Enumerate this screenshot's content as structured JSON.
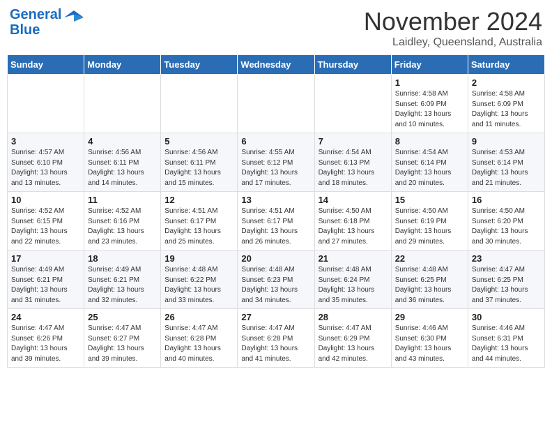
{
  "header": {
    "logo_general": "General",
    "logo_blue": "Blue",
    "month": "November 2024",
    "location": "Laidley, Queensland, Australia"
  },
  "days_of_week": [
    "Sunday",
    "Monday",
    "Tuesday",
    "Wednesday",
    "Thursday",
    "Friday",
    "Saturday"
  ],
  "weeks": [
    [
      {
        "day": "",
        "info": ""
      },
      {
        "day": "",
        "info": ""
      },
      {
        "day": "",
        "info": ""
      },
      {
        "day": "",
        "info": ""
      },
      {
        "day": "",
        "info": ""
      },
      {
        "day": "1",
        "info": "Sunrise: 4:58 AM\nSunset: 6:09 PM\nDaylight: 13 hours\nand 10 minutes."
      },
      {
        "day": "2",
        "info": "Sunrise: 4:58 AM\nSunset: 6:09 PM\nDaylight: 13 hours\nand 11 minutes."
      }
    ],
    [
      {
        "day": "3",
        "info": "Sunrise: 4:57 AM\nSunset: 6:10 PM\nDaylight: 13 hours\nand 13 minutes."
      },
      {
        "day": "4",
        "info": "Sunrise: 4:56 AM\nSunset: 6:11 PM\nDaylight: 13 hours\nand 14 minutes."
      },
      {
        "day": "5",
        "info": "Sunrise: 4:56 AM\nSunset: 6:11 PM\nDaylight: 13 hours\nand 15 minutes."
      },
      {
        "day": "6",
        "info": "Sunrise: 4:55 AM\nSunset: 6:12 PM\nDaylight: 13 hours\nand 17 minutes."
      },
      {
        "day": "7",
        "info": "Sunrise: 4:54 AM\nSunset: 6:13 PM\nDaylight: 13 hours\nand 18 minutes."
      },
      {
        "day": "8",
        "info": "Sunrise: 4:54 AM\nSunset: 6:14 PM\nDaylight: 13 hours\nand 20 minutes."
      },
      {
        "day": "9",
        "info": "Sunrise: 4:53 AM\nSunset: 6:14 PM\nDaylight: 13 hours\nand 21 minutes."
      }
    ],
    [
      {
        "day": "10",
        "info": "Sunrise: 4:52 AM\nSunset: 6:15 PM\nDaylight: 13 hours\nand 22 minutes."
      },
      {
        "day": "11",
        "info": "Sunrise: 4:52 AM\nSunset: 6:16 PM\nDaylight: 13 hours\nand 23 minutes."
      },
      {
        "day": "12",
        "info": "Sunrise: 4:51 AM\nSunset: 6:17 PM\nDaylight: 13 hours\nand 25 minutes."
      },
      {
        "day": "13",
        "info": "Sunrise: 4:51 AM\nSunset: 6:17 PM\nDaylight: 13 hours\nand 26 minutes."
      },
      {
        "day": "14",
        "info": "Sunrise: 4:50 AM\nSunset: 6:18 PM\nDaylight: 13 hours\nand 27 minutes."
      },
      {
        "day": "15",
        "info": "Sunrise: 4:50 AM\nSunset: 6:19 PM\nDaylight: 13 hours\nand 29 minutes."
      },
      {
        "day": "16",
        "info": "Sunrise: 4:50 AM\nSunset: 6:20 PM\nDaylight: 13 hours\nand 30 minutes."
      }
    ],
    [
      {
        "day": "17",
        "info": "Sunrise: 4:49 AM\nSunset: 6:21 PM\nDaylight: 13 hours\nand 31 minutes."
      },
      {
        "day": "18",
        "info": "Sunrise: 4:49 AM\nSunset: 6:21 PM\nDaylight: 13 hours\nand 32 minutes."
      },
      {
        "day": "19",
        "info": "Sunrise: 4:48 AM\nSunset: 6:22 PM\nDaylight: 13 hours\nand 33 minutes."
      },
      {
        "day": "20",
        "info": "Sunrise: 4:48 AM\nSunset: 6:23 PM\nDaylight: 13 hours\nand 34 minutes."
      },
      {
        "day": "21",
        "info": "Sunrise: 4:48 AM\nSunset: 6:24 PM\nDaylight: 13 hours\nand 35 minutes."
      },
      {
        "day": "22",
        "info": "Sunrise: 4:48 AM\nSunset: 6:25 PM\nDaylight: 13 hours\nand 36 minutes."
      },
      {
        "day": "23",
        "info": "Sunrise: 4:47 AM\nSunset: 6:25 PM\nDaylight: 13 hours\nand 37 minutes."
      }
    ],
    [
      {
        "day": "24",
        "info": "Sunrise: 4:47 AM\nSunset: 6:26 PM\nDaylight: 13 hours\nand 39 minutes."
      },
      {
        "day": "25",
        "info": "Sunrise: 4:47 AM\nSunset: 6:27 PM\nDaylight: 13 hours\nand 39 minutes."
      },
      {
        "day": "26",
        "info": "Sunrise: 4:47 AM\nSunset: 6:28 PM\nDaylight: 13 hours\nand 40 minutes."
      },
      {
        "day": "27",
        "info": "Sunrise: 4:47 AM\nSunset: 6:28 PM\nDaylight: 13 hours\nand 41 minutes."
      },
      {
        "day": "28",
        "info": "Sunrise: 4:47 AM\nSunset: 6:29 PM\nDaylight: 13 hours\nand 42 minutes."
      },
      {
        "day": "29",
        "info": "Sunrise: 4:46 AM\nSunset: 6:30 PM\nDaylight: 13 hours\nand 43 minutes."
      },
      {
        "day": "30",
        "info": "Sunrise: 4:46 AM\nSunset: 6:31 PM\nDaylight: 13 hours\nand 44 minutes."
      }
    ]
  ]
}
